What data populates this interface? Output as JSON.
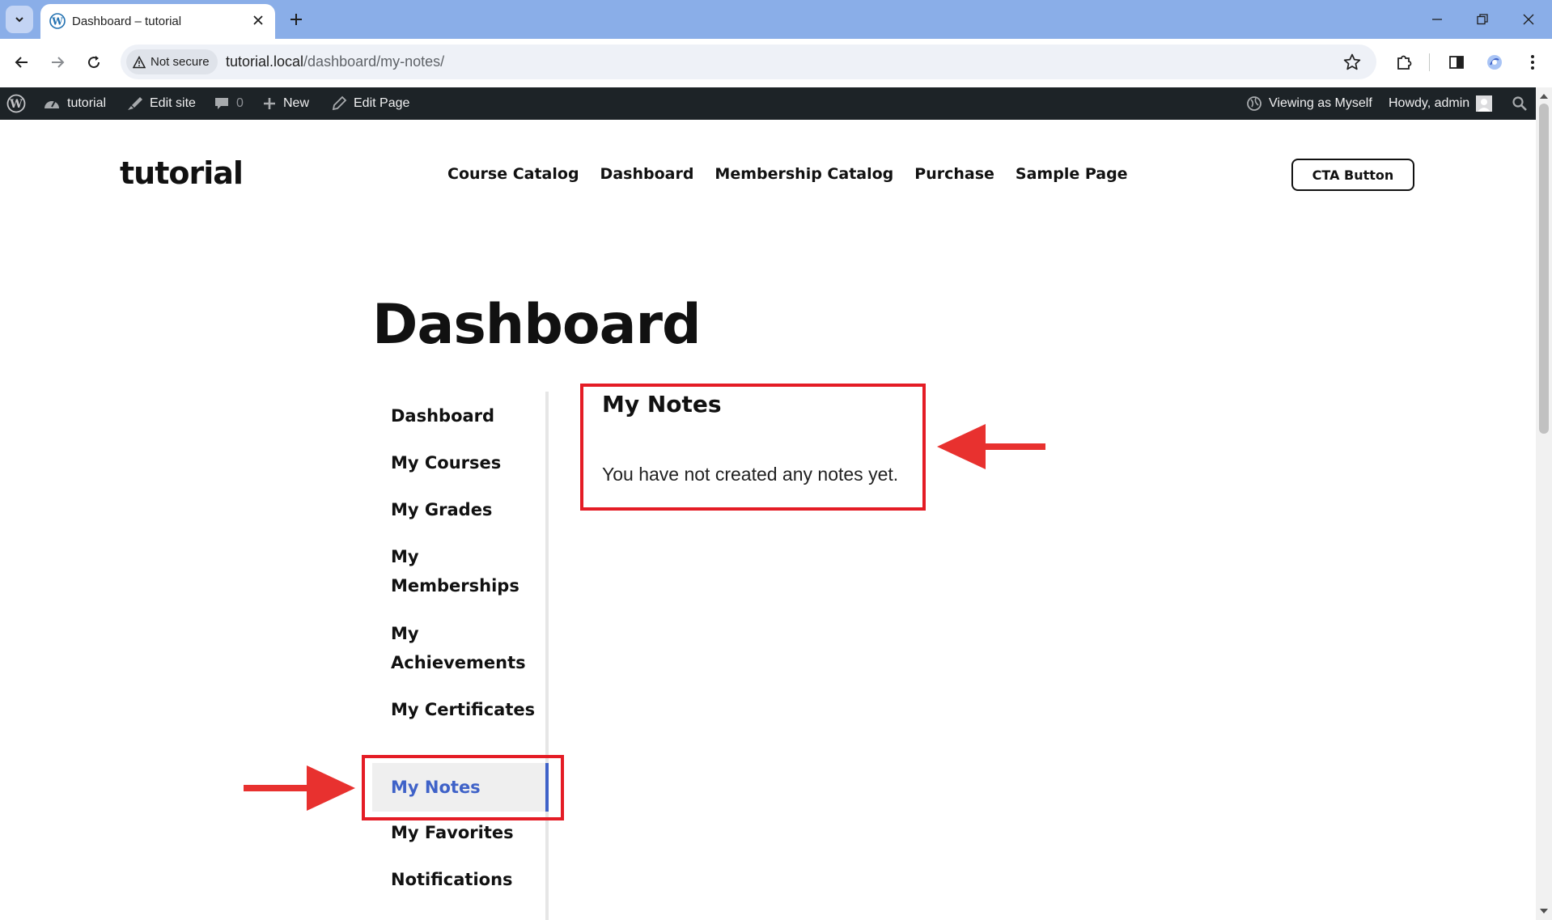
{
  "browser": {
    "tab_title": "Dashboard – tutorial",
    "security_label": "Not secure",
    "url_host": "tutorial.local",
    "url_path": "/dashboard/my-notes/"
  },
  "admin_bar": {
    "site_name": "tutorial",
    "edit_site": "Edit site",
    "comments_count": "0",
    "new_label": "New",
    "edit_page": "Edit Page",
    "viewing_as": "Viewing as Myself",
    "howdy": "Howdy, admin"
  },
  "site": {
    "logo": "tutorial",
    "nav": [
      "Course Catalog",
      "Dashboard",
      "Membership Catalog",
      "Purchase",
      "Sample Page"
    ],
    "cta_label": "CTA Button"
  },
  "page": {
    "title": "Dashboard"
  },
  "sidebar": {
    "items": [
      {
        "label": "Dashboard"
      },
      {
        "label": "My Courses"
      },
      {
        "label": "My Grades"
      },
      {
        "label": "My Memberships"
      },
      {
        "label": "My Achievements"
      },
      {
        "label": "My Certificates"
      },
      {
        "label": "My Notes",
        "active": true
      },
      {
        "label": "My Favorites"
      },
      {
        "label": "Notifications"
      }
    ]
  },
  "content": {
    "heading": "My Notes",
    "empty_message": "You have not created any notes yet."
  },
  "colors": {
    "admin_bar": "#1d2327",
    "accent": "#3f62c8",
    "annotation": "#e41c25",
    "tab_strip": "#8aaee8"
  },
  "icons": {
    "tab_favicon": "wordpress-icon",
    "wp_logo": "wordpress-logo-icon",
    "site_dashboard": "dashboard-gauge-icon",
    "edit_site": "brush-icon",
    "comments": "comment-bubble-icon",
    "new": "plus-icon",
    "edit_page": "pencil-icon",
    "viewing_as": "globe-icon",
    "avatar": "avatar-icon",
    "search": "search-icon"
  }
}
